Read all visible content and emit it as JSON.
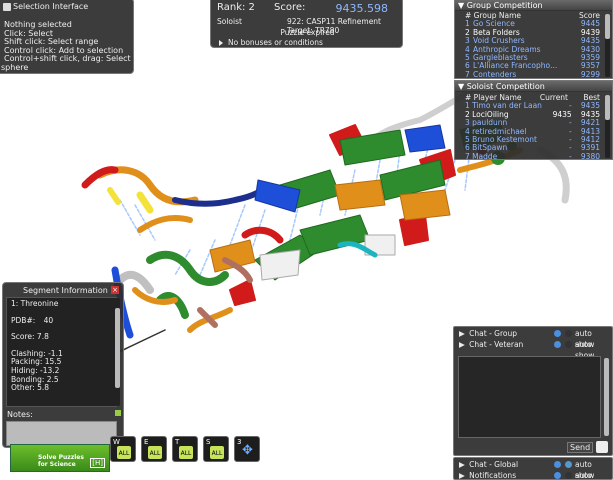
{
  "selection": {
    "title": "Selection Interface",
    "lines": [
      "Nothing selected",
      "Click: Select",
      "Shift click: Select range",
      "Control click: Add to selection",
      "Control+shift click, drag: Select",
      "sphere"
    ]
  },
  "score_panel": {
    "rank_label": "Rank: 2",
    "score_label": "Score:",
    "score_value": "9435.598",
    "mode": "Soloist",
    "puzzle_title": "922: CASP11 Refinement Target: TR780",
    "status": "Puzzle expired",
    "bonus": "No bonuses or conditions"
  },
  "group_competition": {
    "title": "Group Competition",
    "col_name": "# Group Name",
    "col_score": "Score",
    "rows": [
      {
        "rank": "1",
        "name": "Go Science",
        "score": "9445",
        "highlight": false
      },
      {
        "rank": "2",
        "name": "Beta Folders",
        "score": "9439",
        "highlight": true
      },
      {
        "rank": "3",
        "name": "Void Crushers",
        "score": "9435",
        "highlight": false
      },
      {
        "rank": "4",
        "name": "Anthropic Dreams",
        "score": "9430",
        "highlight": false
      },
      {
        "rank": "5",
        "name": "Gargleblasters",
        "score": "9359",
        "highlight": false
      },
      {
        "rank": "6",
        "name": "L'Alliance Francophо...",
        "score": "9357",
        "highlight": false
      },
      {
        "rank": "7",
        "name": "Contenders",
        "score": "9299",
        "highlight": false
      }
    ]
  },
  "soloist_competition": {
    "title": "Soloist Competition",
    "col_name": "# Player Name",
    "col_current": "Current",
    "col_best": "Best",
    "rows": [
      {
        "rank": "1",
        "name": "Timo van der Laan",
        "current": "-",
        "best": "9435",
        "highlight": false
      },
      {
        "rank": "2",
        "name": "LociOiling",
        "current": "9435",
        "best": "9435",
        "highlight": true
      },
      {
        "rank": "3",
        "name": "pauldunn",
        "current": "-",
        "best": "9421",
        "highlight": false
      },
      {
        "rank": "4",
        "name": "retiredmichael",
        "current": "-",
        "best": "9413",
        "highlight": false
      },
      {
        "rank": "5",
        "name": "Bruno Kestemont",
        "current": "-",
        "best": "9412",
        "highlight": false
      },
      {
        "rank": "6",
        "name": "BitSpawn",
        "current": "-",
        "best": "9391",
        "highlight": false
      },
      {
        "rank": "7",
        "name": "Madde",
        "current": "-",
        "best": "9380",
        "highlight": false
      }
    ]
  },
  "segment_info": {
    "title": "Segment Information",
    "residue": "1: Threonine",
    "pdb_label": "PDB#:",
    "pdb_value": "40",
    "score": "Score: 7.8",
    "clashing": "Clashing: -1.1",
    "packing": "Packing: 15.5",
    "hiding": "Hiding: -13.2",
    "bonding": "Bonding: 2.5",
    "other": "Other: 5.8",
    "notes_label": "Notes:"
  },
  "chat": {
    "tabs": [
      {
        "label": "Chat - Group",
        "auto": "auto show"
      },
      {
        "label": "Chat - Veteran",
        "auto": "auto show"
      }
    ],
    "send": "Send",
    "bottom_tabs": [
      {
        "label": "Chat - Global",
        "auto": "auto show"
      },
      {
        "label": "Notifications",
        "auto": "auto show"
      }
    ]
  },
  "toolbar": {
    "buttons": [
      {
        "key": "W",
        "label": "ALL"
      },
      {
        "key": "E",
        "label": "ALL"
      },
      {
        "key": "T",
        "label": "ALL"
      },
      {
        "key": "S",
        "label": "ALL"
      },
      {
        "key": "3",
        "label": ""
      }
    ]
  },
  "logo": {
    "subtitle": "Solve Puzzles for Science",
    "badge": "[H]"
  },
  "colors": {
    "accent_blue": "#8fb8ff",
    "highlight": "#ffffff",
    "protein_green": "#2e8b2e",
    "protein_red": "#d11a1a",
    "protein_orange": "#e0901a",
    "protein_blue": "#1e4fd8"
  }
}
